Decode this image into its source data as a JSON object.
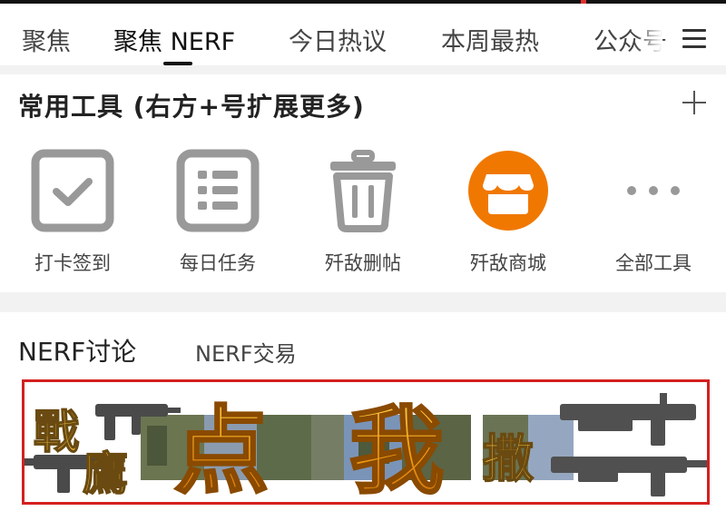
{
  "nav": {
    "tabs": [
      "聚焦",
      "聚焦 NERF",
      "今日热议",
      "本周最热",
      "公众号"
    ],
    "active_index": 1
  },
  "tools": {
    "title": "常用工具 (右方+号扩展更多)",
    "items": [
      {
        "label": "打卡签到",
        "icon": "checkin-icon"
      },
      {
        "label": "每日任务",
        "icon": "tasks-icon"
      },
      {
        "label": "歼敌删帖",
        "icon": "trash-icon"
      },
      {
        "label": "歼敌商城",
        "icon": "store-icon"
      },
      {
        "label": "全部工具",
        "icon": "more-icon"
      }
    ]
  },
  "forum": {
    "tabs": [
      "NERF讨论",
      "NERF交易"
    ],
    "banner": {
      "text_big": [
        "点",
        "我"
      ],
      "text_side": [
        "戰",
        "鷹",
        "撒"
      ]
    }
  },
  "colors": {
    "accent": "#f07800",
    "banner_border": "#d42020",
    "banner_text": "#f2a623"
  }
}
